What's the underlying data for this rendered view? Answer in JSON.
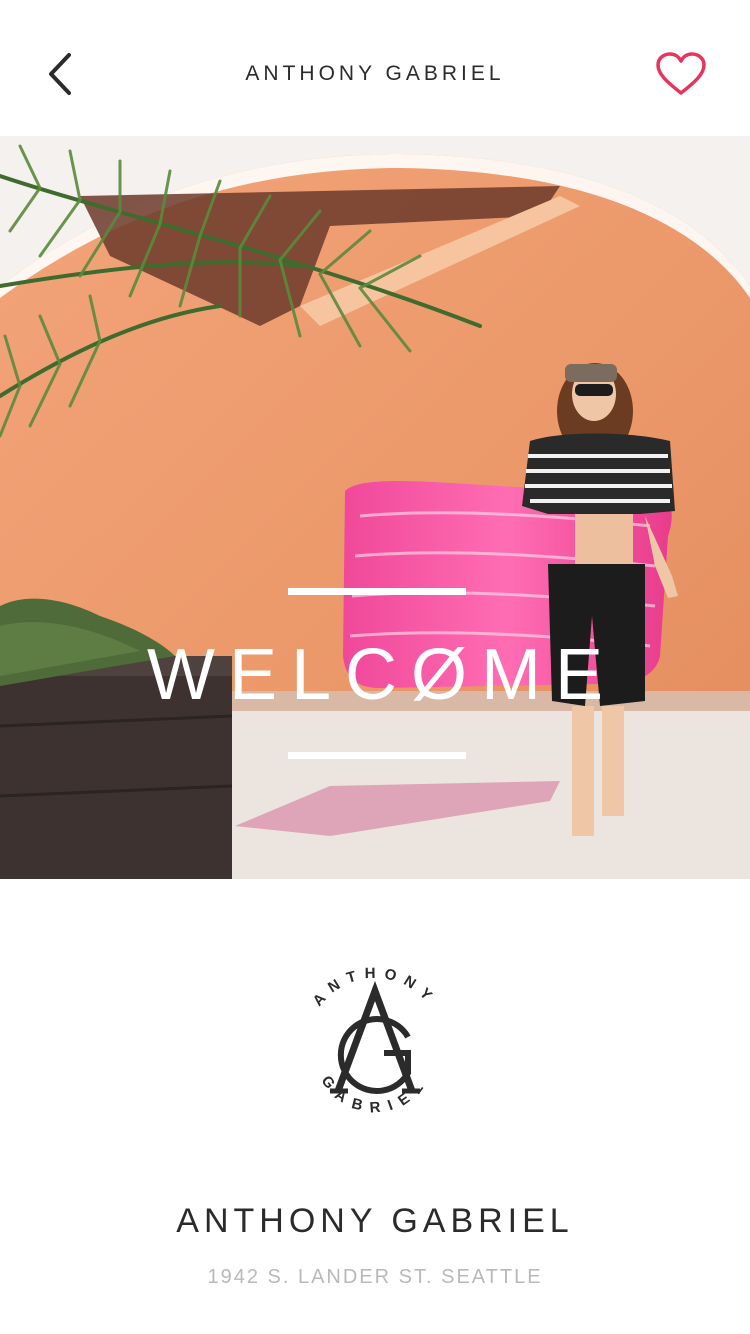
{
  "header": {
    "title": "ANTHONY GABRIEL",
    "back_icon": "chevron-left-icon",
    "favorite_icon": "heart-outline-icon",
    "favorite_color": "#e8345c"
  },
  "hero": {
    "headline": "WELCØME"
  },
  "brand": {
    "logo_ring_text": "ANTHONY GABRIEL",
    "logo_monogram": "AG",
    "name": "ANTHONY GABRIEL",
    "address": "1942 S. LANDER ST. SEATTLE"
  }
}
